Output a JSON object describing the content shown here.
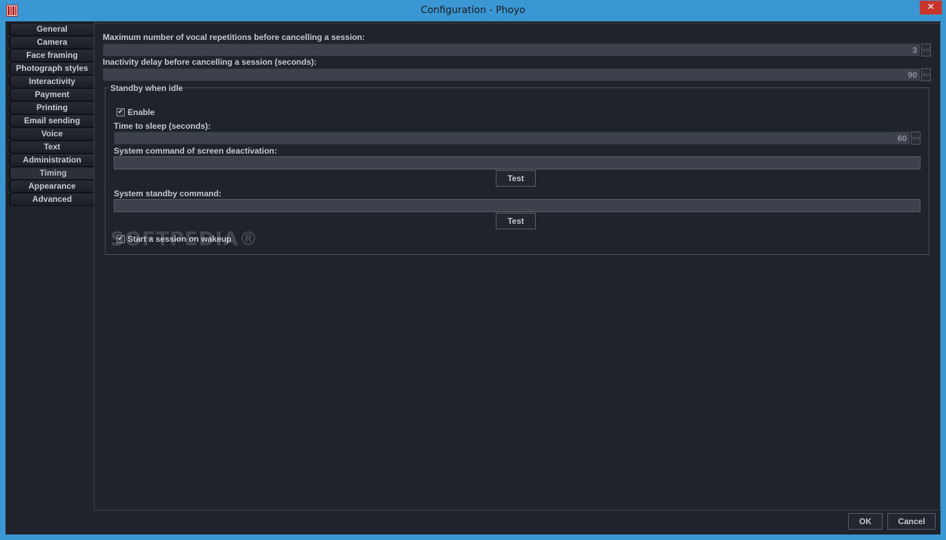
{
  "window": {
    "title": "Configuration - Phoyo",
    "close_label": "✕"
  },
  "tabs": [
    {
      "label": "General"
    },
    {
      "label": "Camera"
    },
    {
      "label": "Face framing"
    },
    {
      "label": "Photograph styles"
    },
    {
      "label": "Interactivity"
    },
    {
      "label": "Payment"
    },
    {
      "label": "Printing"
    },
    {
      "label": "Email sending"
    },
    {
      "label": "Voice"
    },
    {
      "label": "Text"
    },
    {
      "label": "Administration"
    },
    {
      "label": "Timing"
    },
    {
      "label": "Appearance"
    },
    {
      "label": "Advanced"
    }
  ],
  "active_tab": "Timing",
  "fields": {
    "max_repetitions_label": "Maximum number of vocal repetitions before cancelling a session:",
    "max_repetitions_value": "3",
    "inactivity_label": "Inactivity delay before cancelling a session (seconds):",
    "inactivity_value": "90"
  },
  "standby": {
    "title": "Standby when idle",
    "enable_label": "Enable",
    "enable_checked": true,
    "sleep_label": "Time to sleep (seconds):",
    "sleep_value": "60",
    "screen_cmd_label": "System command of screen deactivation:",
    "screen_cmd_value": "",
    "test_label_1": "Test",
    "standby_cmd_label": "System standby command:",
    "standby_cmd_value": "",
    "test_label_2": "Test",
    "wakeup_label": "Start a session on wakeup",
    "wakeup_checked": true
  },
  "footer": {
    "ok_label": "OK",
    "cancel_label": "Cancel"
  },
  "watermark": "SOFTPEDIA®",
  "colors": {
    "titlebar": "#3b97d3",
    "background": "#1f232a",
    "close": "#c7362b"
  }
}
